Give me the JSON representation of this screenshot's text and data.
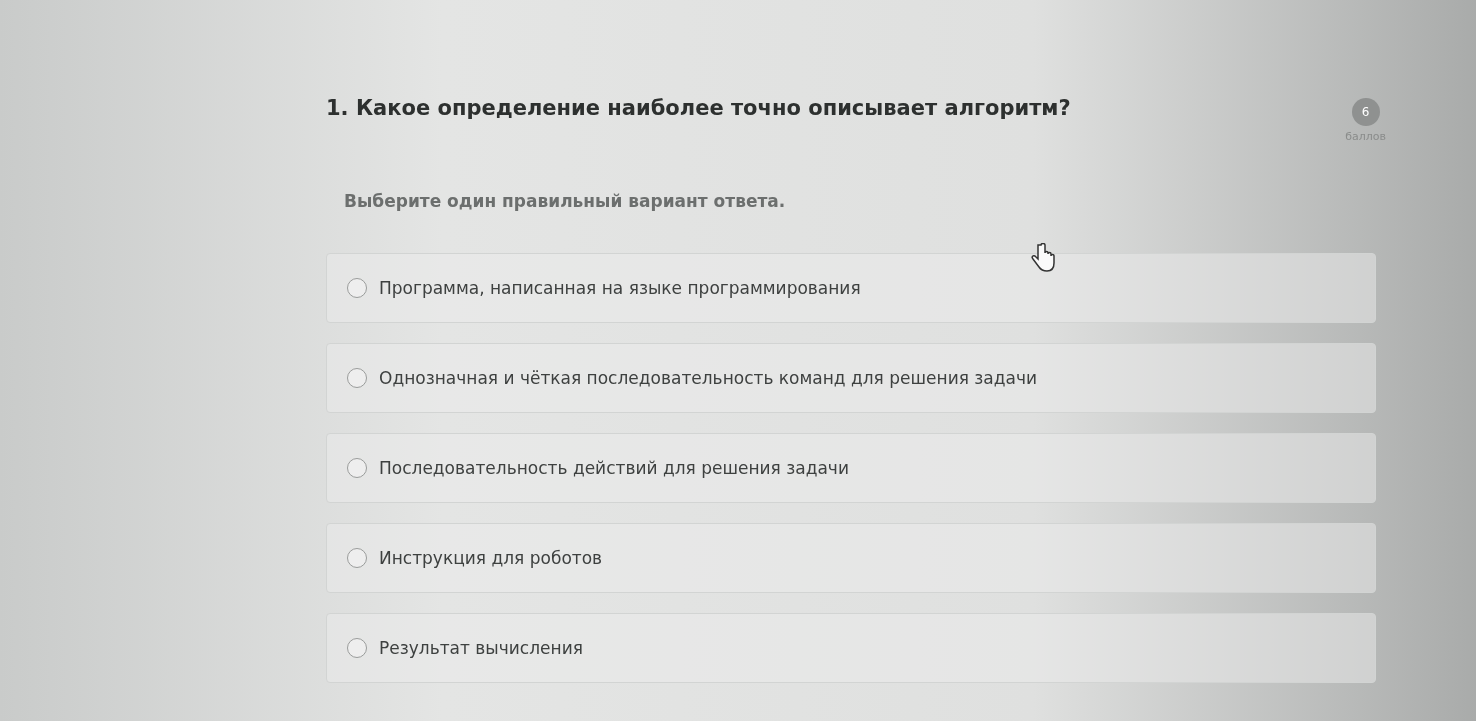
{
  "question": {
    "title": "1. Какое определение наиболее точно описывает алгоритм?",
    "points": "6",
    "points_label": "баллов",
    "instruction": "Выберите один правильный вариант ответа."
  },
  "options": [
    {
      "label": "Программа, написанная на языке программирования",
      "selected": false
    },
    {
      "label": "Однозначная и чёткая последовательность команд для решения задачи",
      "selected": false
    },
    {
      "label": "Последовательность действий для решения задачи",
      "selected": false
    },
    {
      "label": "Инструкция для роботов",
      "selected": false
    },
    {
      "label": "Результат вычисления",
      "selected": false
    }
  ]
}
